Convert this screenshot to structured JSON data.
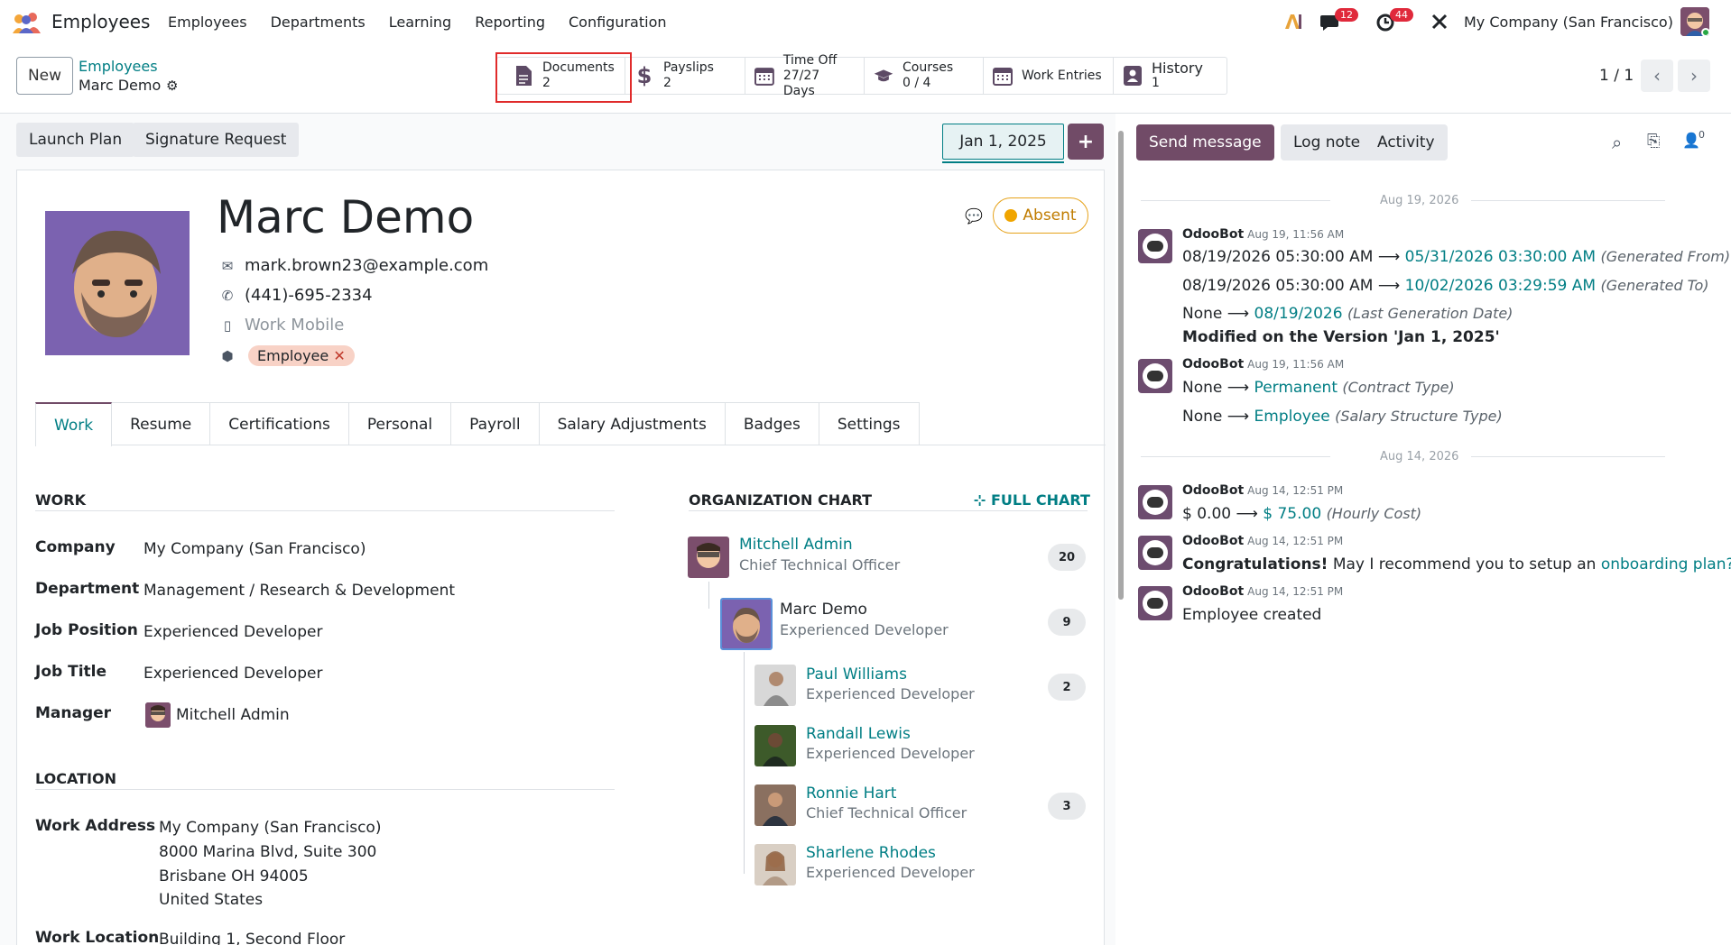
{
  "app": {
    "title": "Employees"
  },
  "menu": [
    "Employees",
    "Departments",
    "Learning",
    "Reporting",
    "Configuration"
  ],
  "systray": {
    "messages_count": "12",
    "activities_count": "44",
    "company": "My Company (San Francisco)"
  },
  "control": {
    "new_label": "New",
    "breadcrumb_parent": "Employees",
    "breadcrumb_current": "Marc Demo",
    "pager": "1 / 1"
  },
  "smart_buttons": [
    {
      "icon": "document-icon",
      "label": "Documents",
      "value": "2"
    },
    {
      "icon": "dollar-icon",
      "label": "Payslips",
      "value": "2"
    },
    {
      "icon": "calendar-icon",
      "label": "Time Off",
      "value": "27/27 Days"
    },
    {
      "icon": "graduation-cap-icon",
      "label": "Courses",
      "value": "0 / 4"
    },
    {
      "icon": "calendar-icon",
      "label": "Work Entries",
      "value": ""
    },
    {
      "icon": "history-icon",
      "label": "History",
      "value": "1"
    }
  ],
  "status": {
    "launch_plan": "Launch Plan",
    "signature_request": "Signature Request",
    "version_date": "Jan 1, 2025",
    "plus": "+"
  },
  "employee": {
    "name": "Marc Demo",
    "email": "mark.brown23@example.com",
    "phone": "(441)-695-2334",
    "mobile_placeholder": "Work Mobile",
    "tag": "Employee",
    "presence": "Absent"
  },
  "tabs": [
    "Work",
    "Resume",
    "Certifications",
    "Personal",
    "Payroll",
    "Salary Adjustments",
    "Badges",
    "Settings"
  ],
  "work": {
    "section": "WORK",
    "fields": [
      {
        "label": "Company",
        "value": "My Company (San Francisco)"
      },
      {
        "label": "Department",
        "value": "Management / Research & Development"
      },
      {
        "label": "Job Position",
        "value": "Experienced Developer"
      },
      {
        "label": "Job Title",
        "value": "Experienced Developer"
      },
      {
        "label": "Manager",
        "value": "Mitchell Admin"
      }
    ]
  },
  "location": {
    "section": "LOCATION",
    "work_address_label": "Work Address",
    "address_lines": [
      "My Company (San Francisco)",
      "8000 Marina Blvd, Suite 300",
      "Brisbane OH 94005",
      "United States"
    ],
    "work_location_label": "Work Location",
    "work_location": "Building 1, Second Floor"
  },
  "org_chart": {
    "title": "ORGANIZATION CHART",
    "full_chart": "FULL CHART",
    "manager": {
      "name": "Mitchell Admin",
      "job": "Chief Technical Officer",
      "count": "20"
    },
    "self": {
      "name": "Marc Demo",
      "job": "Experienced Developer",
      "count": "9"
    },
    "reports": [
      {
        "name": "Paul Williams",
        "job": "Experienced Developer",
        "count": "2"
      },
      {
        "name": "Randall Lewis",
        "job": "Experienced Developer",
        "count": ""
      },
      {
        "name": "Ronnie Hart",
        "job": "Chief Technical Officer",
        "count": "3"
      },
      {
        "name": "Sharlene Rhodes",
        "job": "Experienced Developer",
        "count": ""
      }
    ]
  },
  "chatter": {
    "send_message": "Send message",
    "log_note": "Log note",
    "activity": "Activity",
    "followers_count": "0",
    "date1": "Aug 19, 2026",
    "date2": "Aug 14, 2026",
    "messages": [
      {
        "author": "OdooBot",
        "time": "Aug 19, 11:56 AM"
      },
      {
        "author": "OdooBot",
        "time": "Aug 19, 11:56 AM"
      },
      {
        "author": "OdooBot",
        "time": "Aug 14, 12:51 PM"
      },
      {
        "author": "OdooBot",
        "time": "Aug 14, 12:51 PM"
      },
      {
        "author": "OdooBot",
        "time": "Aug 14, 12:51 PM"
      }
    ],
    "m1": [
      {
        "old": "08/19/2026 05:30:00 AM",
        "new": "05/31/2026 03:30:00 AM",
        "field": "(Generated From)"
      },
      {
        "old": "08/19/2026 05:30:00 AM",
        "new": "10/02/2026 03:29:59 AM",
        "field": "(Generated To)"
      },
      {
        "old": "None",
        "new": "08/19/2026",
        "field": "(Last Generation Date)"
      }
    ],
    "m1_footer": "Modified on the Version 'Jan 1, 2025'",
    "m2": [
      {
        "old": "None",
        "new": "Permanent",
        "field": "(Contract Type)"
      },
      {
        "old": "None",
        "new": "Employee",
        "field": "(Salary Structure Type)"
      }
    ],
    "m3": {
      "old": "$ 0.00",
      "new": "$ 75.00",
      "field": "(Hourly Cost)"
    },
    "m4_bold": "Congratulations!",
    "m4_text": "May I recommend you to setup an",
    "m4_link": "onboarding plan?",
    "m5": "Employee created"
  }
}
